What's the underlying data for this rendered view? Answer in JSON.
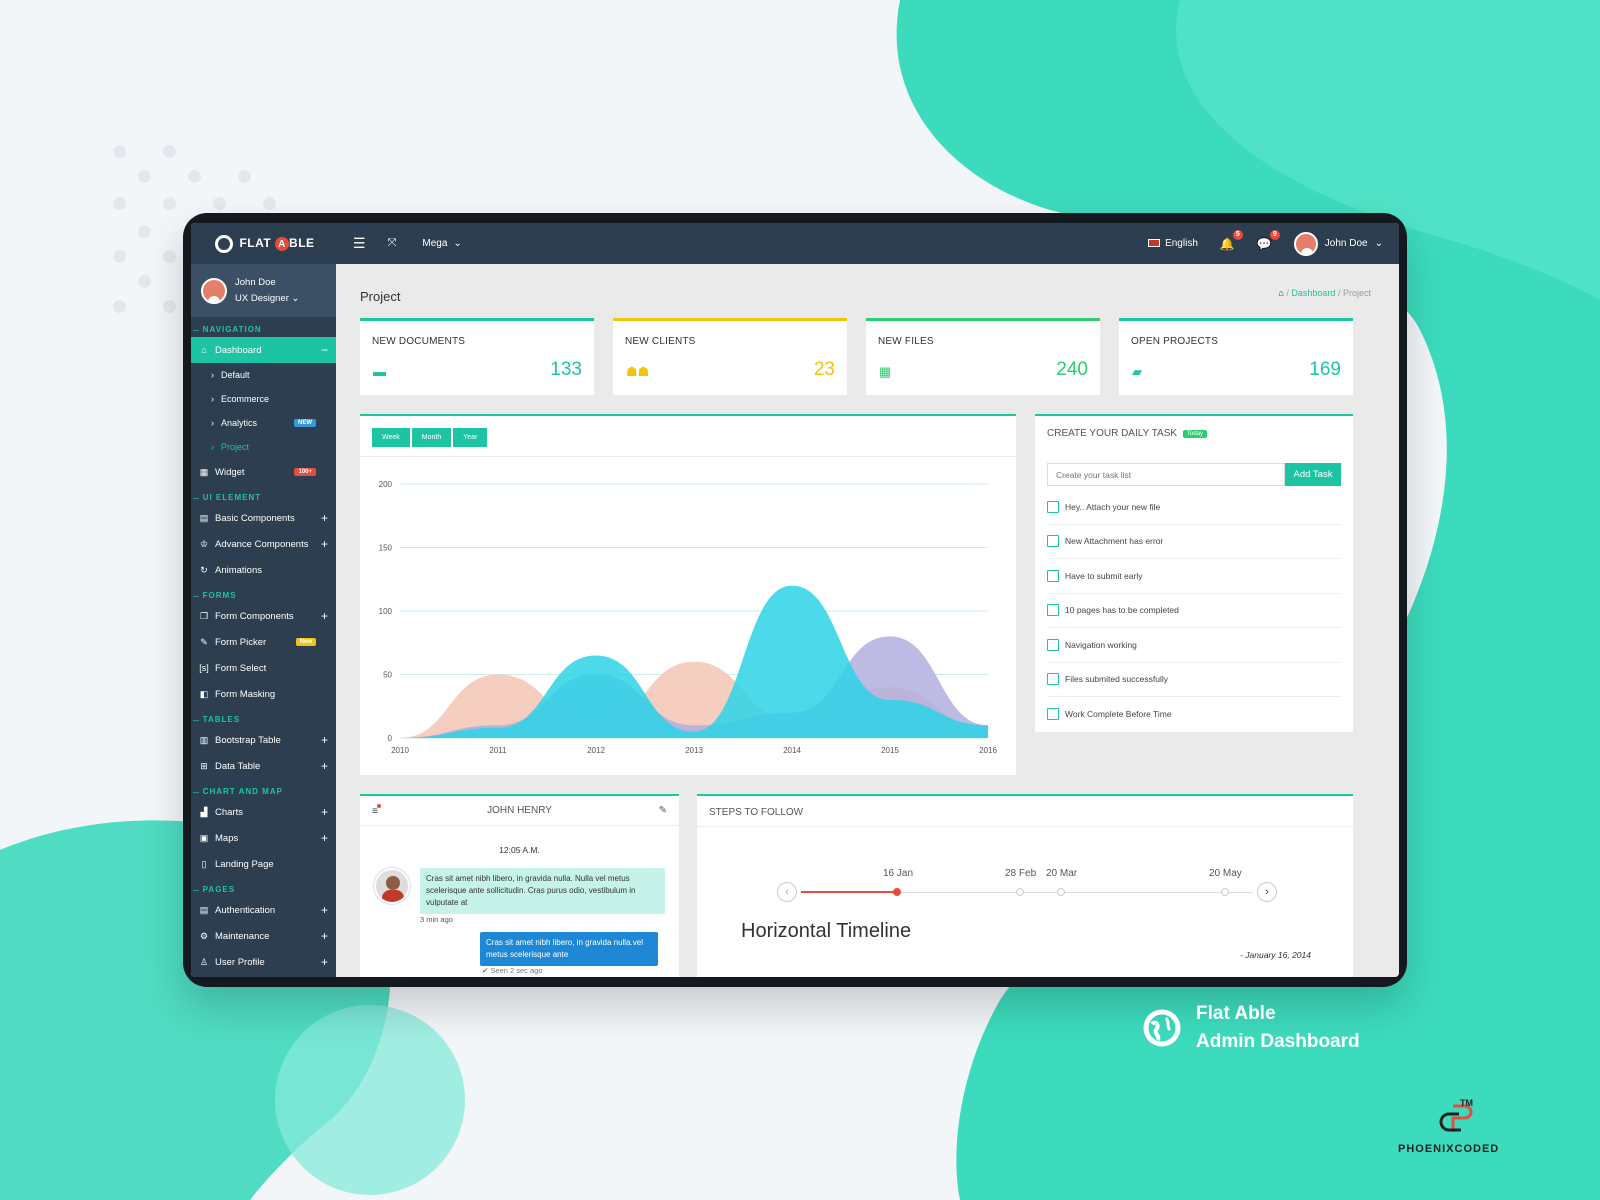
{
  "app": {
    "logo_text": "FLAT ABLE",
    "logo_a": "A"
  },
  "topbar": {
    "mega_label": "Mega",
    "language": "English",
    "notif_count": "5",
    "msg_count": "9",
    "user_name": "John Doe"
  },
  "sidebar": {
    "user_name": "John Doe",
    "user_role": "UX Designer",
    "sections": {
      "navigation": "NAVIGATION",
      "ui_element": "UI ELEMENT",
      "forms": "FORMS",
      "tables": "TABLES",
      "chart_and_map": "CHART AND MAP",
      "pages": "PAGES"
    },
    "items": {
      "dashboard": "Dashboard",
      "default": "Default",
      "ecommerce": "Ecommerce",
      "analytics": "Analytics",
      "analytics_badge": "NEW",
      "project": "Project",
      "widget": "Widget",
      "widget_badge": "100+",
      "basic_components": "Basic Components",
      "advance_components": "Advance Components",
      "animations": "Animations",
      "form_components": "Form Components",
      "form_picker": "Form Picker",
      "form_picker_badge": "New",
      "form_select": "Form Select",
      "form_masking": "Form Masking",
      "bootstrap_table": "Bootstrap Table",
      "data_table": "Data Table",
      "charts": "Charts",
      "maps": "Maps",
      "landing_page": "Landing Page",
      "authentication": "Authentication",
      "maintenance": "Maintenance",
      "user_profile": "User Profile"
    }
  },
  "page": {
    "title": "Project",
    "breadcrumb_1": "Dashboard",
    "breadcrumb_2": "Project"
  },
  "stats": [
    {
      "label": "NEW DOCUMENTS",
      "value": "133",
      "color": "#1dc4a4"
    },
    {
      "label": "NEW CLIENTS",
      "value": "23",
      "color": "#f1c40f"
    },
    {
      "label": "NEW FILES",
      "value": "240",
      "color": "#2ecc71"
    },
    {
      "label": "OPEN PROJECTS",
      "value": "169",
      "color": "#1dc4a4"
    }
  ],
  "chart_tabs": {
    "week": "Week",
    "month": "Month",
    "year": "Year"
  },
  "chart_data": {
    "type": "area",
    "x": [
      "2010",
      "2011",
      "2012",
      "2013",
      "2014",
      "2015",
      "2016"
    ],
    "ylim": [
      0,
      200
    ],
    "yticks": [
      "0",
      "50",
      "100",
      "150",
      "200"
    ],
    "series": [
      {
        "color": "#f5c6b5",
        "values": [
          0,
          50,
          10,
          60,
          15,
          40,
          5
        ]
      },
      {
        "color": "#b2aedf",
        "values": [
          0,
          10,
          50,
          10,
          20,
          80,
          10
        ]
      },
      {
        "color": "#2dd4e6",
        "values": [
          0,
          8,
          65,
          5,
          120,
          30,
          10
        ]
      }
    ]
  },
  "tasks": {
    "title": "CREATE YOUR DAILY TASK",
    "badge": "Today",
    "placeholder": "Create your task list",
    "button": "Add Task",
    "items": [
      "Hey.. Attach your new file",
      "New Attachment has error",
      "Have to submit early",
      "10 pages has to be completed",
      "Navigation working",
      "Files submited successfully",
      "Work Complete Before Time"
    ]
  },
  "chat": {
    "name": "JOHN HENRY",
    "time": "12:05 A.M.",
    "msg_in": "Cras sit amet nibh libero, in gravida nulla. Nulla vel metus scelerisque ante sollicitudin. Cras purus odio, vestibulum in vulputate at",
    "msg_in_time": "3 min ago",
    "msg_out": "Cras sit amet nibh libero, in gravida nulla.vel metus scelerisque ante",
    "msg_out_time": "Seen 2 sec ago"
  },
  "steps": {
    "title": "STEPS TO FOLLOW",
    "dates": [
      "16 Jan",
      "28 Feb",
      "20 Mar",
      "20 May"
    ],
    "heading": "Horizontal Timeline",
    "signature": "- January 16, 2014"
  },
  "brand": {
    "line1": "Flat Able",
    "line2": "Admin Dashboard",
    "company": "PHOENIXCODED",
    "tm": "TM"
  },
  "colors": {
    "accent": "#1dc4a4",
    "sidebar": "#2c3e50",
    "danger": "#e74c3c"
  }
}
